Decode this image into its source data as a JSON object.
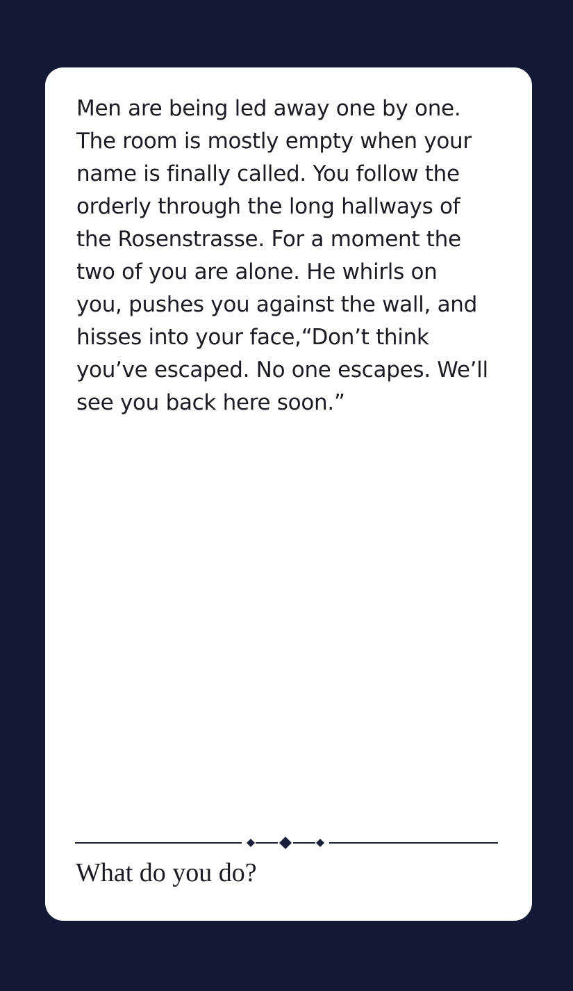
{
  "card": {
    "story_text": "Men are being led away one by one.\nThe room is mostly empty when your\nname is finally called. You follow the\norderly through the long hallways of\nthe Rosenstrasse. For a moment the\ntwo of you are alone. He whirls on\nyou, pushes you against the wall, and\nhisses into your face,“Don’t think\nyou’ve escaped. No one escapes. We’ll\nsee you back here soon.”",
    "prompt": "What do you do?",
    "divider_icon": "diamond-ornament-icon"
  },
  "colors": {
    "background": "#131935",
    "card": "#ffffff",
    "text": "#1b1b24",
    "ornament": "#1a1f3a"
  }
}
